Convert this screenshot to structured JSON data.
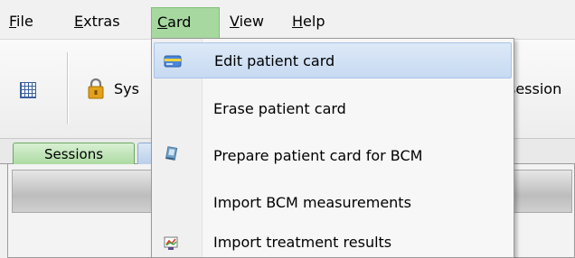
{
  "menubar": {
    "items": [
      {
        "mnemonic": "F",
        "rest": "ile"
      },
      {
        "mnemonic": "E",
        "rest": "xtras"
      },
      {
        "mnemonic": "C",
        "rest": "ard"
      },
      {
        "mnemonic": "V",
        "rest": "iew"
      },
      {
        "mnemonic": "H",
        "rest": "elp"
      }
    ]
  },
  "toolbar": {
    "sys_label": "Sys",
    "session_label": "session"
  },
  "tabs": {
    "sessions_label": "Sessions"
  },
  "card_menu": {
    "items": [
      {
        "label": "Edit patient card",
        "icon": "card-icon"
      },
      {
        "label": "Erase patient card",
        "icon": ""
      },
      {
        "label": "Prepare patient card for BCM",
        "icon": "card-device-icon"
      },
      {
        "label": "Import BCM measurements",
        "icon": ""
      },
      {
        "label": "Import treatment results",
        "icon": "treatment-results-icon"
      }
    ]
  },
  "colors": {
    "active_menu": "#a7d8a0",
    "highlight": "#c7daf2",
    "tab_green": "#a9d99f"
  }
}
